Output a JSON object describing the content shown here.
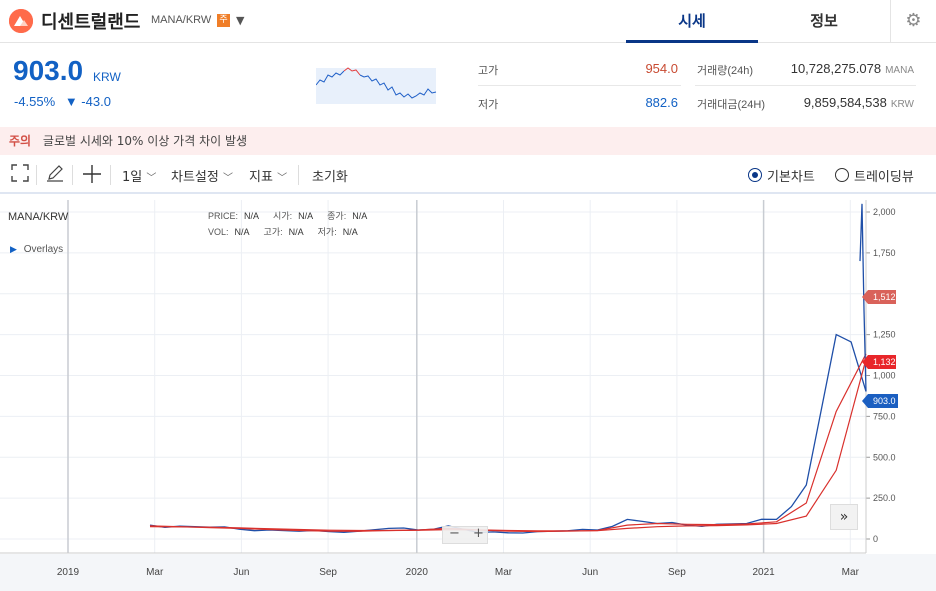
{
  "header": {
    "coin_name": "디센트럴랜드",
    "pair": "MANA/KRW",
    "badge": "주",
    "tabs": [
      {
        "label": "시세",
        "active": true
      },
      {
        "label": "정보",
        "active": false
      }
    ]
  },
  "summary": {
    "price": "903.0",
    "price_unit": "KRW",
    "change_pct": "-4.55%",
    "change_abs": "▼ -43.0",
    "high_label": "고가",
    "high_value": "954.0",
    "low_label": "저가",
    "low_value": "882.6",
    "volume_label": "거래량(24h)",
    "volume_value": "10,728,275.078",
    "volume_unit": "MANA",
    "amount_label": "거래대금(24H)",
    "amount_value": "9,859,584,538",
    "amount_unit": "KRW"
  },
  "notice": {
    "tag": "주의",
    "text": "글로벌 시세와 10% 이상 가격 차이 발생"
  },
  "toolbar": {
    "interval": "1일",
    "chart_settings": "차트설정",
    "indicators": "지표",
    "reset": "초기화",
    "basic_chart": "기본차트",
    "trading_view": "트레이딩뷰"
  },
  "chart": {
    "symbol": "MANA/KRW",
    "overlays": "Overlays",
    "ohlc": {
      "price_label": "PRICE:",
      "price": "N/A",
      "open_label": "시가:",
      "open": "N/A",
      "close_label": "종가:",
      "close": "N/A",
      "vol_label": "VOL:",
      "vol": "N/A",
      "high_label": "고가:",
      "high": "N/A",
      "low_label": "저가:",
      "low": "N/A"
    },
    "tags": {
      "ma_long": "1,512",
      "ma_mid": "1,132",
      "last": "903.0"
    },
    "colors": {
      "price": "#1f4fa8",
      "ma_red": "#d9302c",
      "tag_ma_long": "#d9625a",
      "tag_ma_mid": "#e8262a",
      "tag_last": "#1b5fc1"
    }
  },
  "chart_data": {
    "type": "line",
    "title": "MANA/KRW",
    "y_ticks": [
      "0",
      "250.0",
      "500.0",
      "750.0",
      "1,000",
      "1,250",
      "1,500",
      "1,750",
      "2,000"
    ],
    "x_ticks": [
      "2019",
      "Mar",
      "Jun",
      "Sep",
      "2020",
      "Mar",
      "Jun",
      "Sep",
      "2021",
      "Mar"
    ],
    "ylim": [
      0,
      2000
    ],
    "x": [
      "2019-04",
      "2019-05",
      "2019-06",
      "2019-07",
      "2019-08",
      "2019-09",
      "2019-10",
      "2019-11",
      "2019-12",
      "2020-01",
      "2020-02",
      "2020-03",
      "2020-04",
      "2020-05",
      "2020-06",
      "2020-07",
      "2020-08",
      "2020-09",
      "2020-10",
      "2020-11",
      "2020-12",
      "2021-01",
      "2021-02",
      "2021-03",
      "2021-04"
    ],
    "series": [
      {
        "values": [
          85,
          78,
          72,
          60,
          55,
          48,
          45,
          48,
          65,
          55,
          80,
          40,
          38,
          45,
          50,
          55,
          120,
          95,
          85,
          90,
          95,
          120,
          330,
          1250,
          903
        ]
      },
      {
        "values": [
          80,
          75,
          70,
          65,
          58,
          52,
          48,
          47,
          52,
          55,
          65,
          55,
          48,
          46,
          48,
          52,
          85,
          95,
          90,
          88,
          92,
          105,
          220,
          780,
          1132
        ]
      },
      {
        "values": [
          75,
          74,
          72,
          68,
          63,
          58,
          54,
          52,
          52,
          53,
          57,
          56,
          52,
          50,
          50,
          51,
          65,
          75,
          80,
          82,
          86,
          95,
          140,
          420,
          1100
        ]
      }
    ],
    "grid": true
  }
}
